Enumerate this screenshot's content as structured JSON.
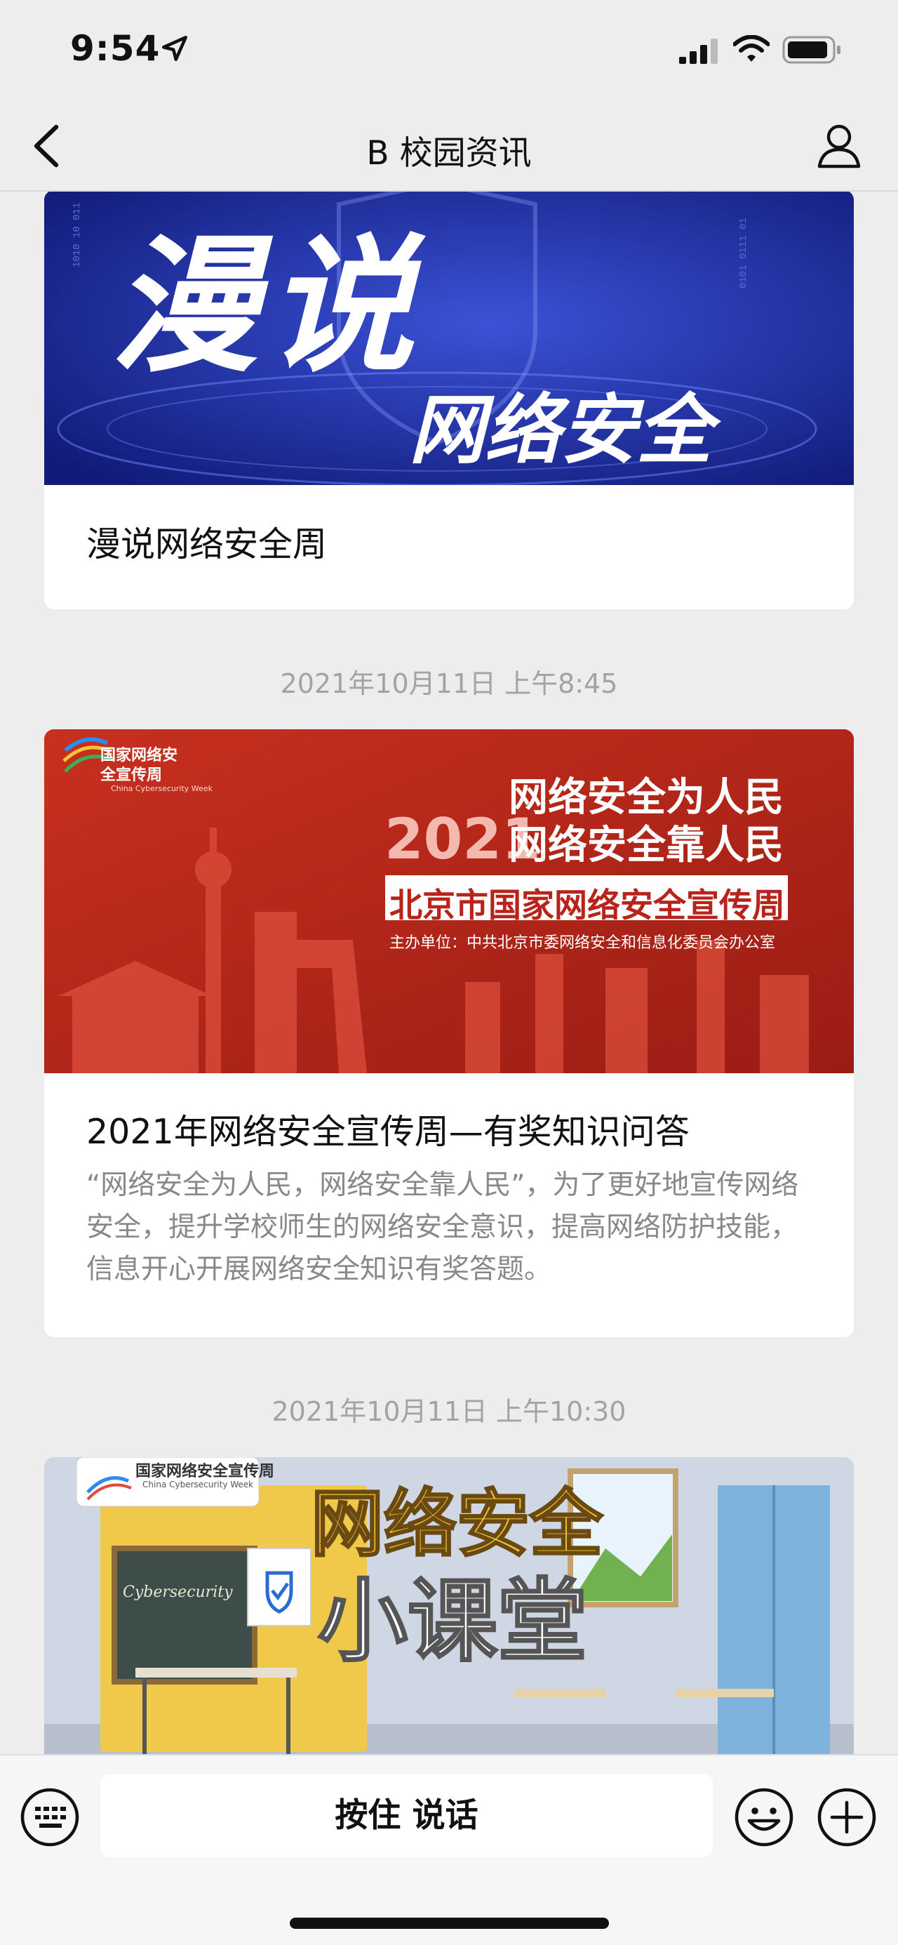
{
  "status_bar": {
    "time": "9:54"
  },
  "nav": {
    "title": "B 校园资讯"
  },
  "feed": {
    "article1": {
      "banner_big": "漫说",
      "banner_sub": "网络安全",
      "title": "漫说网络安全周"
    },
    "timestamp1": "2021年10月11日 上午8:45",
    "article2": {
      "banner_logo": "国家网络安全宣传周",
      "banner_logo_en": "China Cybersecurity Week",
      "banner_year": "2021",
      "banner_slogan1": "网络安全为人民",
      "banner_slogan2": "网络安全靠人民",
      "banner_event": "北京市国家网络安全宣传周",
      "banner_host": "主办单位：中共北京市委网络安全和信息化委员会办公室",
      "title": "2021年网络安全宣传周—有奖知识问答",
      "description": "“网络安全为人民，网络安全靠人民”，为了更好地宣传网络安全，提升学校师生的网络安全意识，提高网络防护技能，信息开心开展网络安全知识有奖答题。"
    },
    "timestamp2": "2021年10月11日 上午10:30",
    "article3": {
      "banner_logo": "国家网络安全宣传周",
      "banner_logo_en": "China Cybersecurity Week",
      "banner_line1": "网络安全",
      "banner_line2": "小课堂",
      "banner_board": "Cybersecurity"
    }
  },
  "input_bar": {
    "hold_to_talk": "按住 说话"
  },
  "colors": {
    "background": "#ededed",
    "card": "#ffffff",
    "timestamp": "#a3a3a3",
    "banner1": "#1a2a9e",
    "banner2": "#b8231c"
  },
  "icons": [
    "location-arrow-icon",
    "signal-icon",
    "wifi-icon",
    "battery-icon",
    "back-icon",
    "profile-icon",
    "keyboard-icon",
    "emoji-icon",
    "plus-icon"
  ]
}
